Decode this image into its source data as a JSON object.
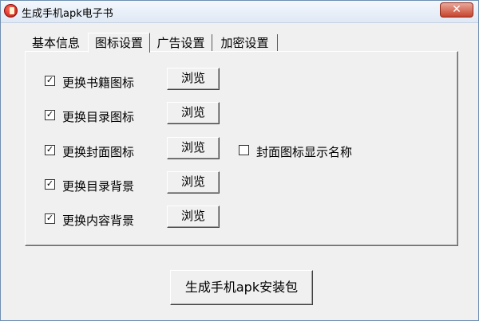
{
  "window": {
    "title": "生成手机apk电子书",
    "close_glyph": "✕"
  },
  "tabs": [
    {
      "label": "基本信息",
      "active": false
    },
    {
      "label": "图标设置",
      "active": true
    },
    {
      "label": "广告设置",
      "active": false
    },
    {
      "label": "加密设置",
      "active": false
    }
  ],
  "options": [
    {
      "label": "更换书籍图标",
      "checked": true,
      "button_label": "浏览"
    },
    {
      "label": "更换目录图标",
      "checked": true,
      "button_label": "浏览"
    },
    {
      "label": "更换封面图标",
      "checked": true,
      "button_label": "浏览"
    },
    {
      "label": "更换目录背景",
      "checked": true,
      "button_label": "浏览"
    },
    {
      "label": "更换内容背景",
      "checked": true,
      "button_label": "浏览"
    }
  ],
  "cover_name_option": {
    "label": "封面图标显示名称",
    "checked": false
  },
  "checkmark_glyph": "✓",
  "main_button_label": "生成手机apk安装包"
}
